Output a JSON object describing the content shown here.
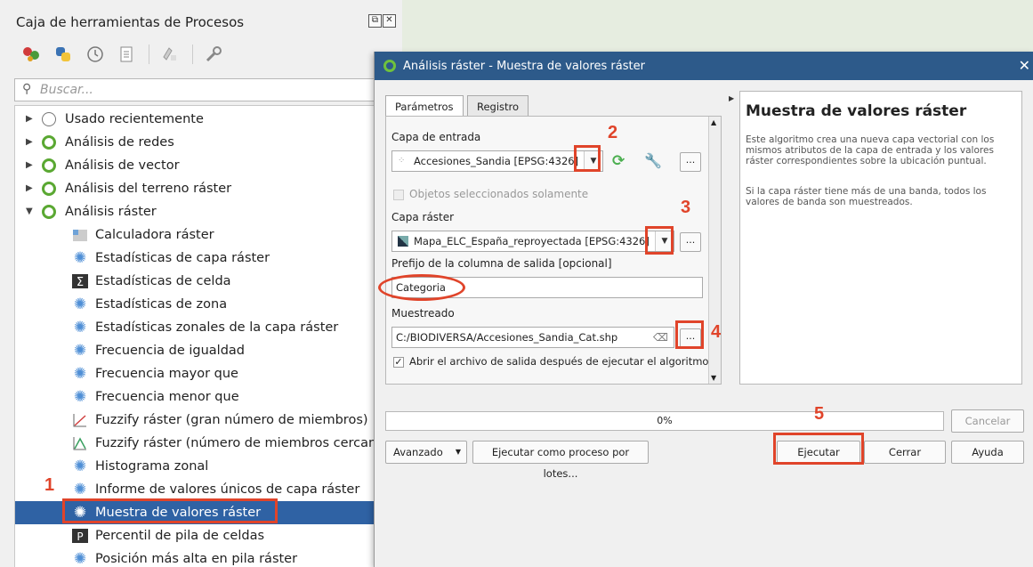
{
  "toolbox": {
    "title": "Caja de herramientas de Procesos",
    "search_placeholder": "Buscar...",
    "items": [
      {
        "label": "Usado recientemente"
      },
      {
        "label": "Análisis de redes"
      },
      {
        "label": "Análisis de vector"
      },
      {
        "label": "Análisis del terreno ráster"
      },
      {
        "label": "Análisis ráster"
      },
      {
        "label": "Calculadora ráster"
      },
      {
        "label": "Estadísticas de capa ráster"
      },
      {
        "label": "Estadísticas de celda"
      },
      {
        "label": "Estadísticas de zona"
      },
      {
        "label": "Estadísticas zonales de la capa ráster"
      },
      {
        "label": "Frecuencia de igualdad"
      },
      {
        "label": "Frecuencia mayor que"
      },
      {
        "label": "Frecuencia menor que"
      },
      {
        "label": "Fuzzify ráster (gran número de miembros)"
      },
      {
        "label": "Fuzzify ráster (número de miembros cercanos"
      },
      {
        "label": "Histograma zonal"
      },
      {
        "label": "Informe de valores únicos de capa ráster"
      },
      {
        "label": "Muestra de valores ráster"
      },
      {
        "label": "Percentil de pila de celdas"
      },
      {
        "label": "Posición más alta en pila ráster"
      }
    ]
  },
  "dialog": {
    "title": "Análisis ráster - Muestra de valores ráster",
    "tabs": [
      "Parámetros",
      "Registro"
    ],
    "input_layer_label": "Capa de entrada",
    "input_layer_value": "Accesiones_Sandia [EPSG:4326]",
    "selected_only_label": "Objetos seleccionados solamente",
    "raster_layer_label": "Capa ráster",
    "raster_layer_value": "Mapa_ELC_España_reproyectada [EPSG:4326]",
    "prefix_label": "Prefijo de la columna de salida [opcional]",
    "prefix_value": "Categoria",
    "sampled_label": "Muestreado",
    "sampled_value": "C:/BIODIVERSA/Accesiones_Sandia_Cat.shp",
    "open_output_label": "Abrir el archivo de salida después de ejecutar el algoritmo",
    "dots": "...",
    "help_title": "Muestra de valores ráster",
    "help_p1": "Este algoritmo crea una nueva capa vectorial con los mismos atributos de la capa de entrada y los valores ráster correspondientes sobre la ubicación puntual.",
    "help_p2": "Si la capa ráster tiene más de una banda, todos los valores de banda son muestreados.",
    "progress_text": "0%",
    "progress_value": 0,
    "cancel_label": "Cancelar",
    "advanced_label": "Avanzado",
    "batch_label": "Ejecutar como proceso por lotes...",
    "run_label": "Ejecutar",
    "close_label": "Cerrar",
    "help_label": "Ayuda"
  },
  "annotations": {
    "n1": "1",
    "n2": "2",
    "n3": "3",
    "n4": "4",
    "n5": "5",
    "color": "#e0442a"
  }
}
